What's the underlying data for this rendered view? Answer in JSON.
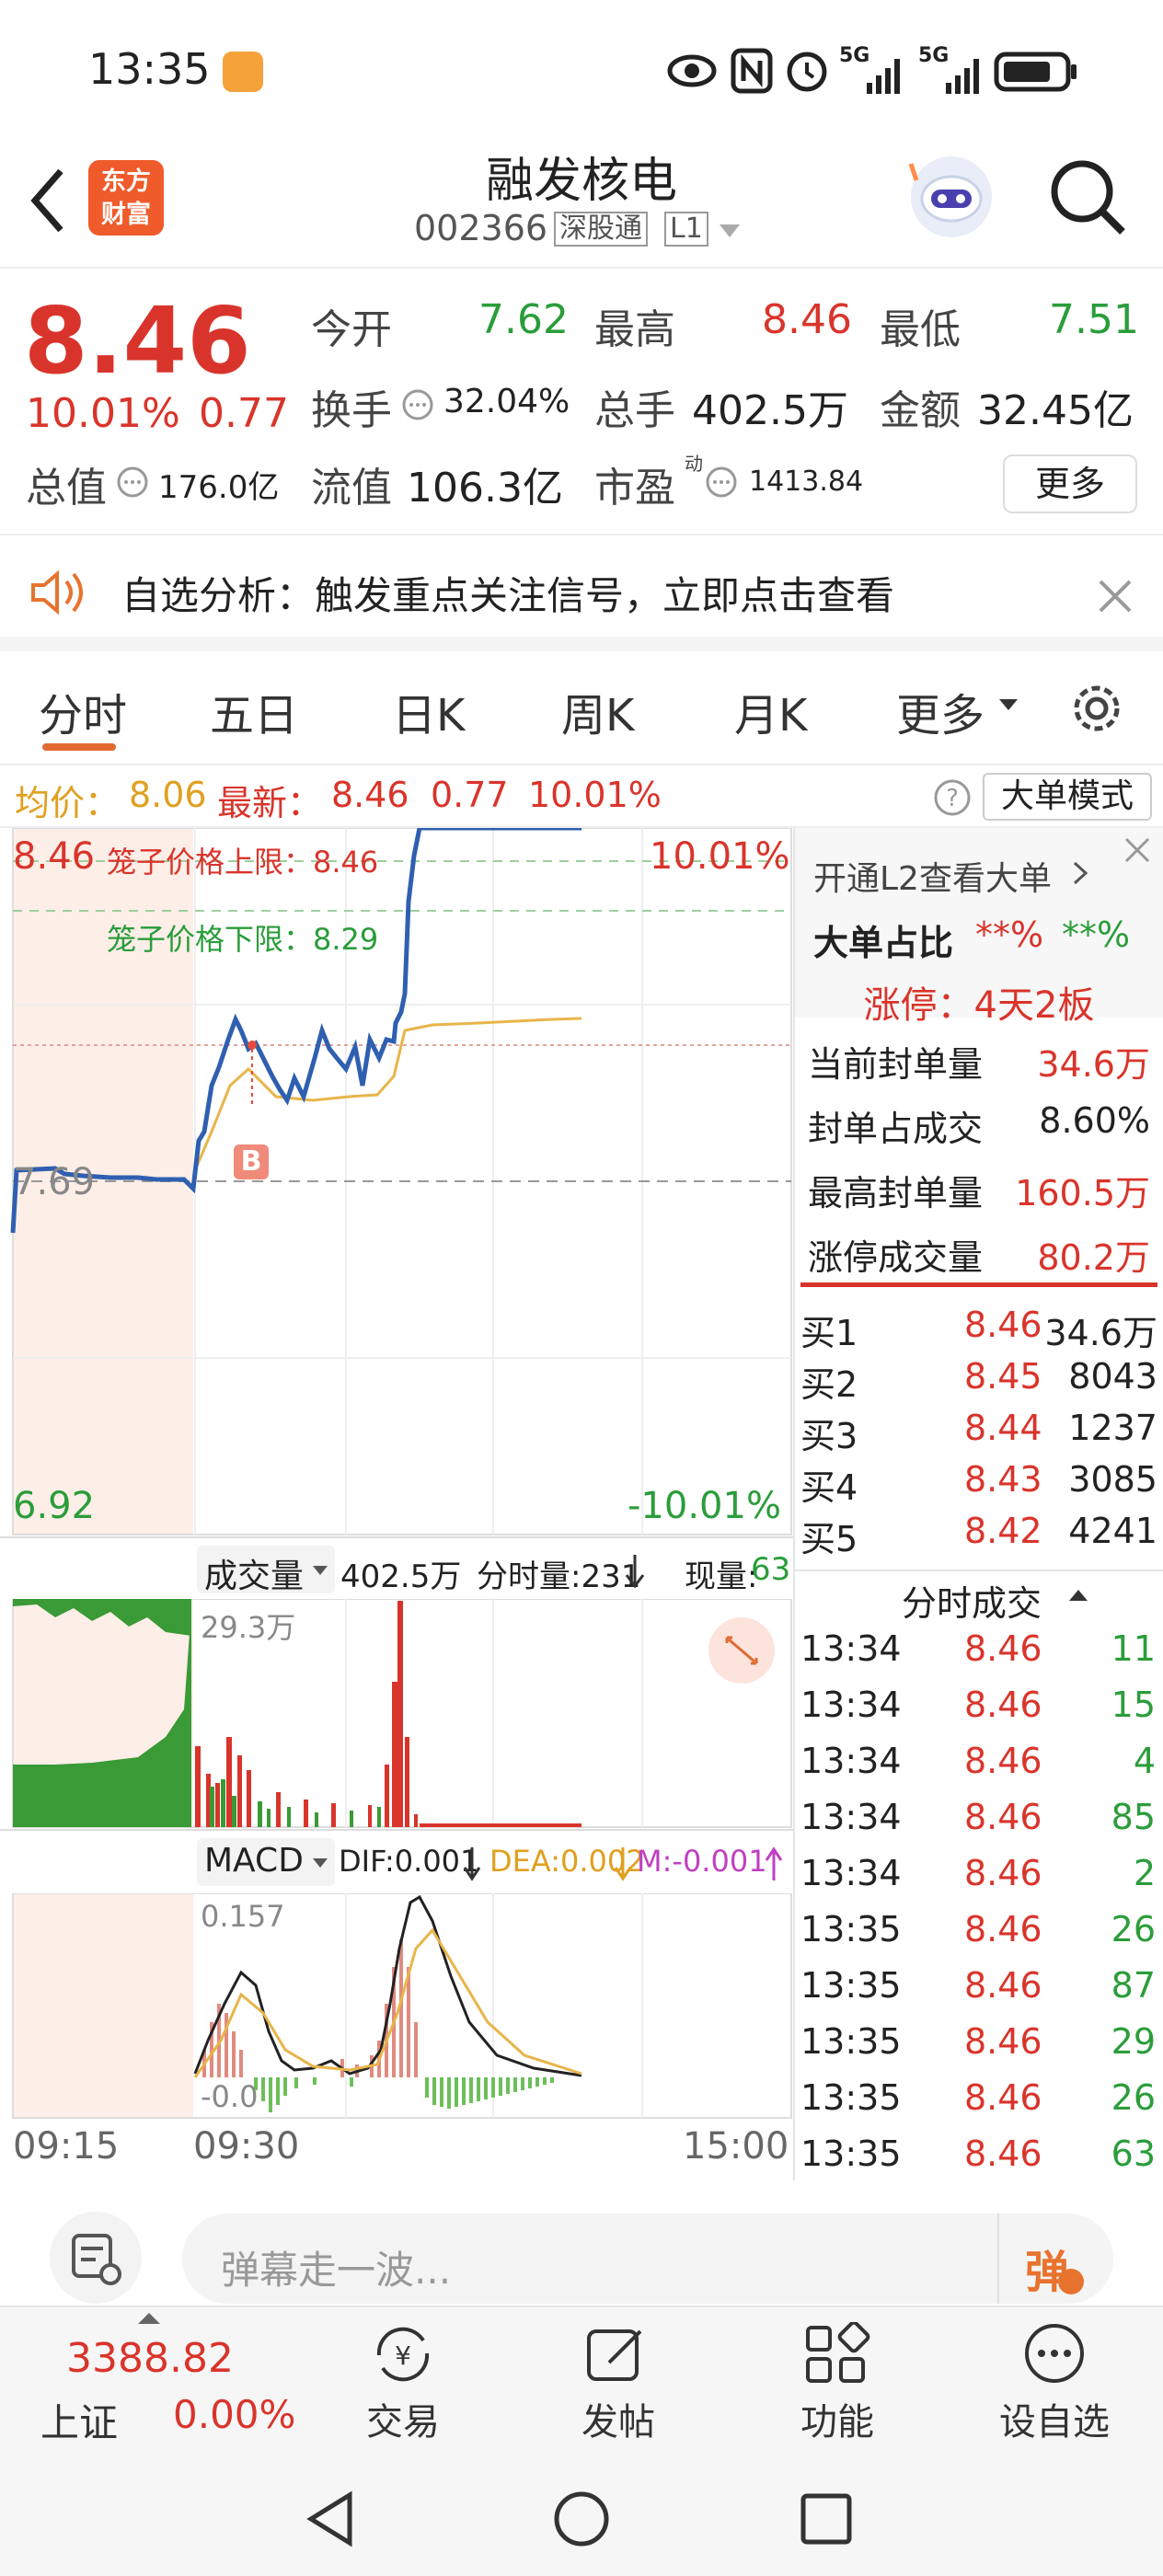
{
  "status": {
    "time": "13:35",
    "net1": "5G",
    "net2": "5G"
  },
  "header": {
    "brand_line1": "东方",
    "brand_line2": "财富",
    "stock_name": "融发核电",
    "stock_code": "002366",
    "tag1": "深股通",
    "tag2": "L1"
  },
  "quote": {
    "price": "8.46",
    "change_pct": "10.01%",
    "change": "0.77",
    "open_label": "今开",
    "open": "7.62",
    "high_label": "最高",
    "high": "8.46",
    "low_label": "最低",
    "low": "7.51",
    "turnover_label": "换手",
    "turnover": "32.04%",
    "volume_label": "总手",
    "volume": "402.5万",
    "amount_label": "金额",
    "amount": "32.45亿",
    "mcap_label": "总值",
    "mcap": "176.0亿",
    "float_label": "流值",
    "float": "106.3亿",
    "pe_label": "市盈",
    "pe_sup": "动",
    "pe": "1413.84",
    "more": "更多"
  },
  "alert": {
    "text": "自选分析：触发重点关注信号，立即点击查看"
  },
  "tabs": [
    "分时",
    "五日",
    "日K",
    "周K",
    "月K",
    "更多"
  ],
  "chart_header": {
    "avg_label": "均价：",
    "avg": "8.06",
    "latest_label": "最新：",
    "latest": "8.46",
    "chg": "0.77",
    "pct": "10.01%",
    "mode": "大单模式"
  },
  "intraday": {
    "top_price": "8.46",
    "top_pct": "10.01%",
    "mid_price": "7.69",
    "bot_price": "6.92",
    "bot_pct": "-10.01%",
    "cage_upper": "笼子价格上限：8.46",
    "cage_lower": "笼子价格下限：8.29",
    "marker": "B"
  },
  "volume_bar": {
    "label": "成交量",
    "total": "402.5万",
    "tick_label": "分时量:231",
    "now_label": "现量:",
    "now": "63",
    "max": "29.3万"
  },
  "macd": {
    "label": "MACD",
    "dif": "DIF:0.001",
    "dea": "DEA:0.002",
    "m": "M:-0.001",
    "top": "0.157",
    "bottom": "-0.0"
  },
  "time_axis": {
    "start": "09:15",
    "open": "09:30",
    "end": "15:00"
  },
  "side": {
    "l2_link": "开通L2查看大单",
    "big_ratio_label": "大单占比",
    "big_ratio_1": "**%",
    "big_ratio_2": "**%",
    "limit_up": "涨停：4天2板",
    "stats": [
      {
        "label": "当前封单量",
        "value": "34.6万",
        "cls": "red"
      },
      {
        "label": "封单占成交",
        "value": "8.60%",
        "cls": ""
      },
      {
        "label": "最高封单量",
        "value": "160.5万",
        "cls": "red"
      },
      {
        "label": "涨停成交量",
        "value": "80.2万",
        "cls": "red"
      }
    ],
    "bids": [
      {
        "label": "买1",
        "price": "8.46",
        "vol": "34.6万"
      },
      {
        "label": "买2",
        "price": "8.45",
        "vol": "8043"
      },
      {
        "label": "买3",
        "price": "8.44",
        "vol": "1237"
      },
      {
        "label": "买4",
        "price": "8.43",
        "vol": "3085"
      },
      {
        "label": "买5",
        "price": "8.42",
        "vol": "4241"
      }
    ],
    "ticks_title": "分时成交",
    "ticks": [
      {
        "t": "13:34",
        "p": "8.46",
        "v": "11"
      },
      {
        "t": "13:34",
        "p": "8.46",
        "v": "15"
      },
      {
        "t": "13:34",
        "p": "8.46",
        "v": "4"
      },
      {
        "t": "13:34",
        "p": "8.46",
        "v": "85"
      },
      {
        "t": "13:34",
        "p": "8.46",
        "v": "2"
      },
      {
        "t": "13:35",
        "p": "8.46",
        "v": "26"
      },
      {
        "t": "13:35",
        "p": "8.46",
        "v": "87"
      },
      {
        "t": "13:35",
        "p": "8.46",
        "v": "29"
      },
      {
        "t": "13:35",
        "p": "8.46",
        "v": "26"
      },
      {
        "t": "13:35",
        "p": "8.46",
        "v": "63"
      }
    ]
  },
  "comment": {
    "placeholder": "弹幕走一波...",
    "danmu": "弹"
  },
  "bottom_nav": {
    "index_value": "3388.82",
    "index_name": "上证",
    "index_pct": "0.00%",
    "trade": "交易",
    "post": "发帖",
    "feature": "功能",
    "watch": "设自选"
  }
}
